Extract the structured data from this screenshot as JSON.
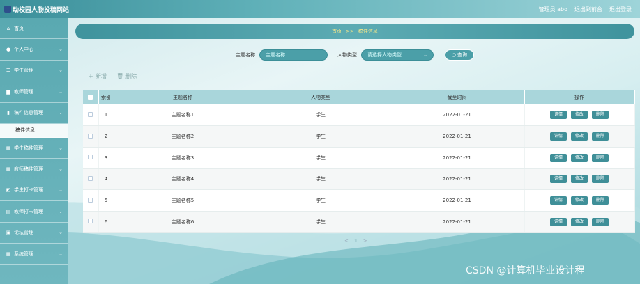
{
  "header": {
    "title": "动校园人物投稿网站",
    "admin_label": "管理员 abo",
    "back_label": "退出到前台",
    "logout_label": "退出登录"
  },
  "sidebar": {
    "items": [
      {
        "icon": "home-icon",
        "label": "首页",
        "glyph": "⌂",
        "has_chevron": false
      },
      {
        "icon": "user-icon",
        "label": "个人中心",
        "glyph": "●",
        "has_chevron": true
      },
      {
        "icon": "list-icon",
        "label": "学生管理",
        "glyph": "☰",
        "has_chevron": true
      },
      {
        "icon": "card-icon",
        "label": "教师管理",
        "glyph": "▆",
        "has_chevron": true
      },
      {
        "icon": "bar-chart-icon",
        "label": "稿件信息管理",
        "glyph": "▮",
        "has_chevron": true
      },
      {
        "icon": "grid-icon",
        "label": "学生稿件管理",
        "glyph": "▦",
        "has_chevron": true
      },
      {
        "icon": "grid-icon",
        "label": "教师稿件管理",
        "glyph": "▦",
        "has_chevron": true
      },
      {
        "icon": "chart-icon",
        "label": "学生打卡管理",
        "glyph": "◩",
        "has_chevron": true
      },
      {
        "icon": "table-icon",
        "label": "教师打卡管理",
        "glyph": "▤",
        "has_chevron": true
      },
      {
        "icon": "forum-icon",
        "label": "论坛管理",
        "glyph": "▣",
        "has_chevron": true
      },
      {
        "icon": "grid-icon",
        "label": "系统管理",
        "glyph": "▦",
        "has_chevron": true
      }
    ],
    "active_sub": "稿件信息"
  },
  "breadcrumb": {
    "home": "首页",
    "sep": ">>",
    "current": "稿件信息"
  },
  "search": {
    "title_label": "主题名称",
    "title_placeholder": "主题名称",
    "type_label": "人物类型",
    "type_placeholder": "请选择人物类型",
    "button_label": "查询"
  },
  "actions": {
    "add_label": "新增",
    "delete_label": "删除"
  },
  "table": {
    "headers": [
      "索引",
      "主题名称",
      "人物类型",
      "截至时间",
      "操作"
    ],
    "rows": [
      {
        "index": "1",
        "title": "主题名称1",
        "type": "学生",
        "date": "2022-01-21"
      },
      {
        "index": "2",
        "title": "主题名称2",
        "type": "学生",
        "date": "2022-01-21"
      },
      {
        "index": "3",
        "title": "主题名称3",
        "type": "学生",
        "date": "2022-01-21"
      },
      {
        "index": "4",
        "title": "主题名称4",
        "type": "学生",
        "date": "2022-01-21"
      },
      {
        "index": "5",
        "title": "主题名称5",
        "type": "学生",
        "date": "2022-01-21"
      },
      {
        "index": "6",
        "title": "主题名称6",
        "type": "学生",
        "date": "2022-01-21"
      }
    ],
    "op_labels": {
      "detail": "详情",
      "edit": "修改",
      "delete": "删除"
    }
  },
  "pager": {
    "prev": "<",
    "current": "1",
    "next": ">"
  },
  "watermark": "CSDN @计算机毕业设计程",
  "colors": {
    "accent": "#3f8f98",
    "header_bg": "#a9d6db",
    "breadcrumb_text": "#f3e68a"
  }
}
